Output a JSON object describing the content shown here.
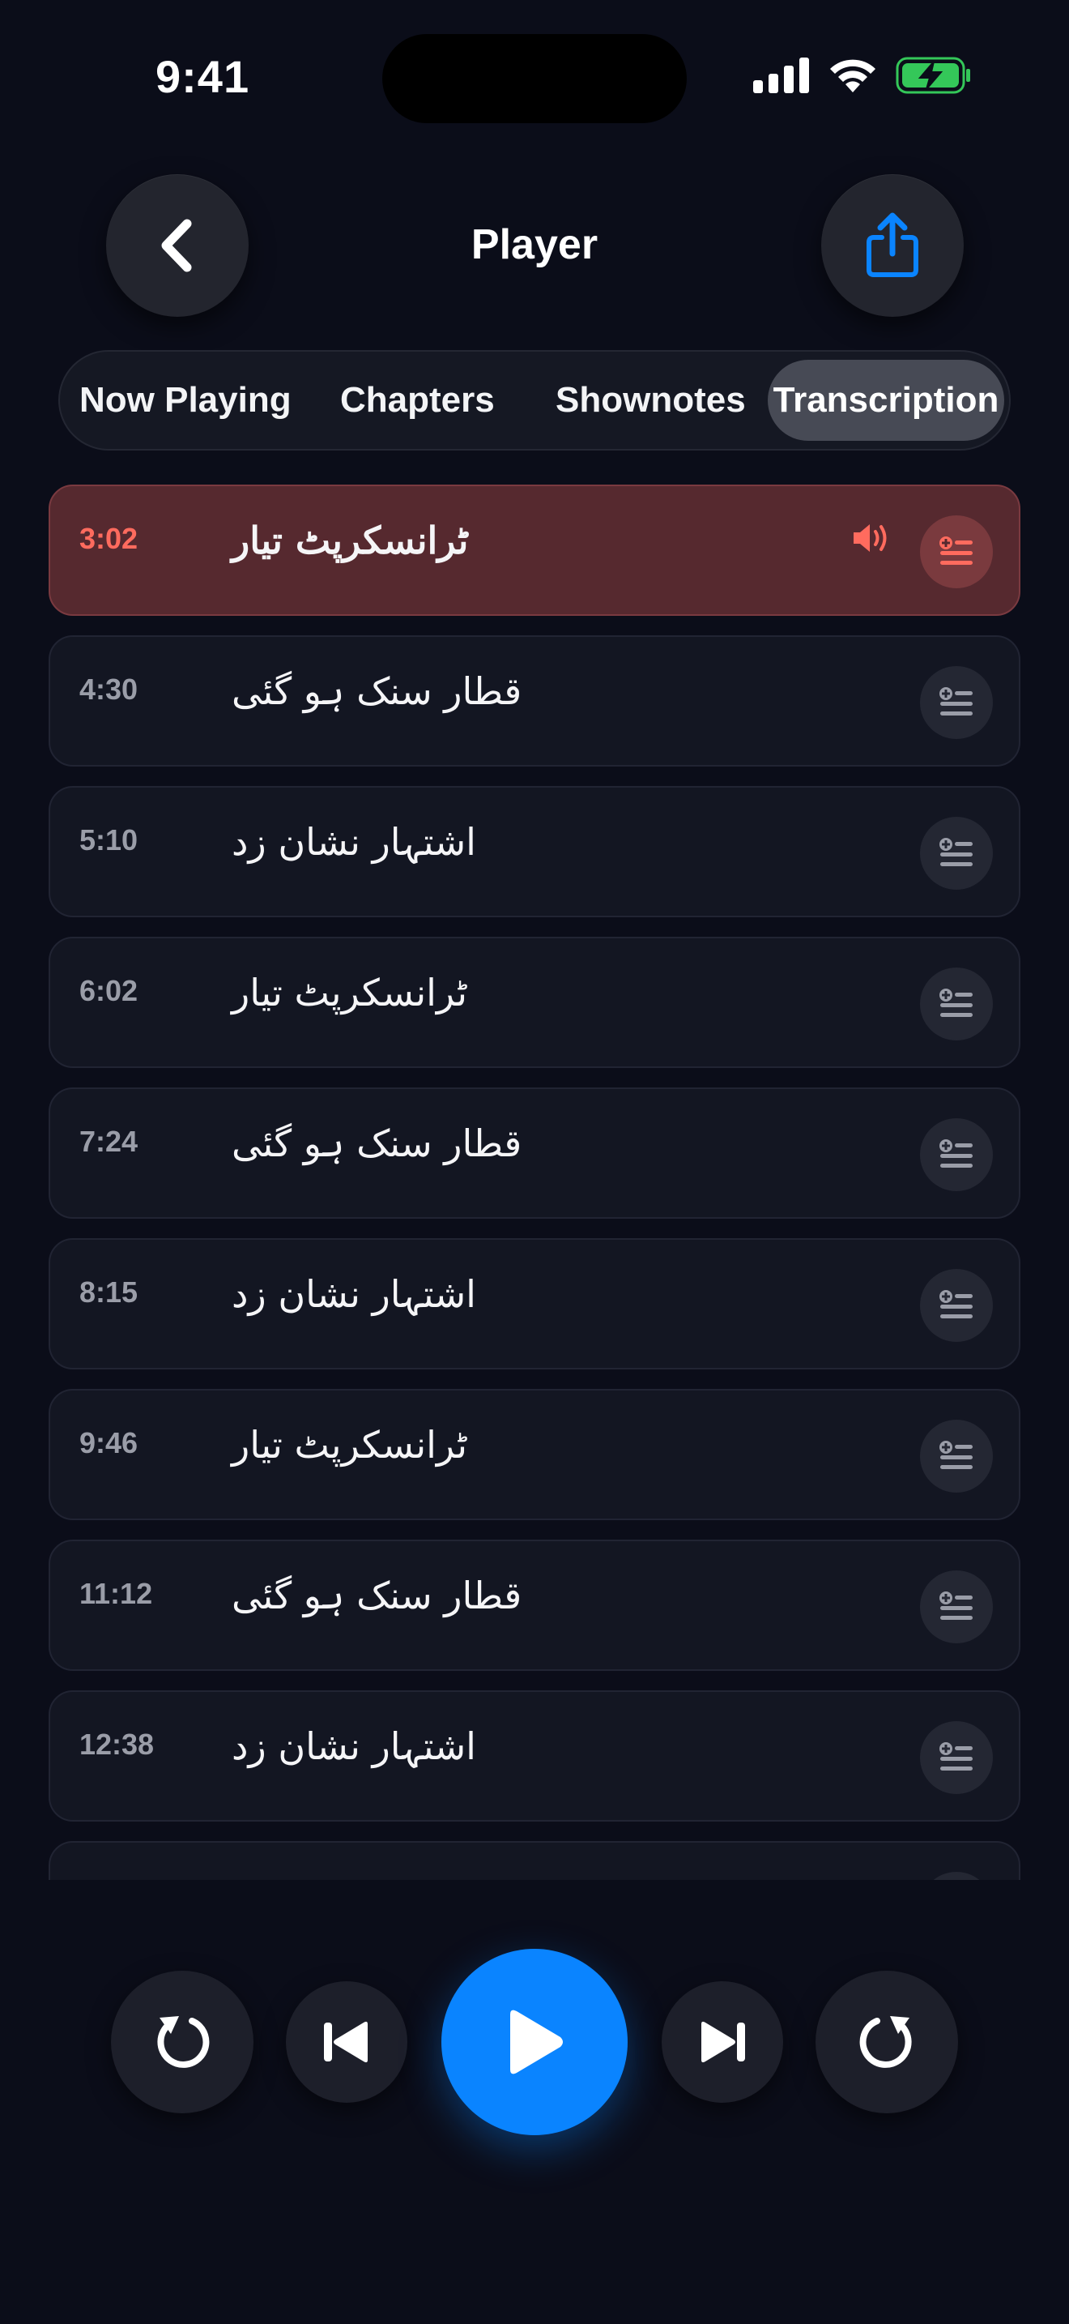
{
  "status_bar": {
    "time": "9:41"
  },
  "header": {
    "title": "Player"
  },
  "tabs": [
    {
      "label": "Now Playing",
      "selected": false
    },
    {
      "label": "Chapters",
      "selected": false
    },
    {
      "label": "Shownotes",
      "selected": false
    },
    {
      "label": "Transcription",
      "selected": true
    }
  ],
  "transcript": [
    {
      "time": "3:02",
      "text": "ٹرانسکرپٹ تیار",
      "active": true
    },
    {
      "time": "4:30",
      "text": "قطار سنک ہو گئی",
      "active": false
    },
    {
      "time": "5:10",
      "text": "اشتہار نشان زد",
      "active": false
    },
    {
      "time": "6:02",
      "text": "ٹرانسکرپٹ تیار",
      "active": false
    },
    {
      "time": "7:24",
      "text": "قطار سنک ہو گئی",
      "active": false
    },
    {
      "time": "8:15",
      "text": "اشتہار نشان زد",
      "active": false
    },
    {
      "time": "9:46",
      "text": "ٹرانسکرپٹ تیار",
      "active": false
    },
    {
      "time": "11:12",
      "text": "قطار سنک ہو گئی",
      "active": false
    },
    {
      "time": "12:38",
      "text": "اشتہار نشان زد",
      "active": false
    },
    {
      "time": "",
      "text": "",
      "active": false
    }
  ],
  "colors": {
    "background": "#0b0d19",
    "accent_blue": "#0a84ff",
    "active_row": "#56292f",
    "active_time": "#ff6b5e",
    "battery_green": "#34c759"
  },
  "icons": {
    "back": "chevron-left-icon",
    "share": "share-icon",
    "row_action": "add-to-queue-icon",
    "speaker": "speaker-wave-icon",
    "rewind": "rewind-icon",
    "previous": "skip-back-icon",
    "play": "play-icon",
    "next": "skip-forward-icon",
    "forward": "forward-icon"
  }
}
